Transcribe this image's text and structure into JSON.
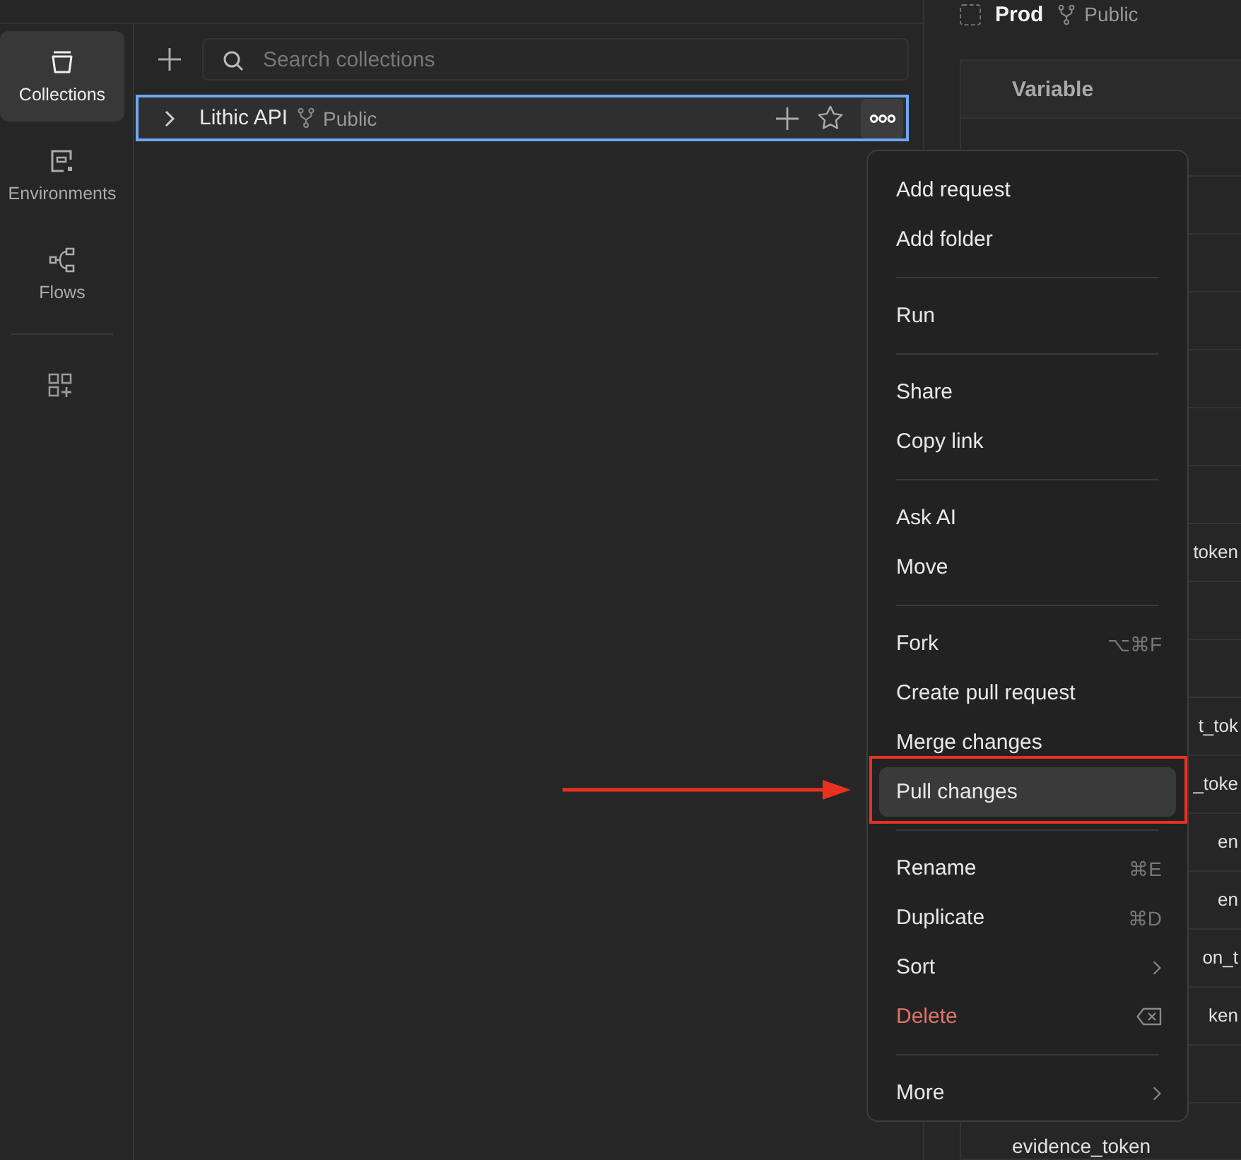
{
  "nav": [
    {
      "label": "Collections",
      "selected": true
    },
    {
      "label": "Environments",
      "selected": false
    },
    {
      "label": "Flows",
      "selected": false
    }
  ],
  "search": {
    "placeholder": "Search collections"
  },
  "collection": {
    "name": "Lithic API",
    "visibility": "Public",
    "selected": true
  },
  "environment": {
    "name": "Prod",
    "visibility": "Public"
  },
  "table": {
    "columns": [
      "Variable"
    ],
    "rows": [
      {
        "kind": "blank"
      },
      {
        "kind": "blank"
      },
      {
        "kind": "blank"
      },
      {
        "kind": "blank"
      },
      {
        "kind": "blank"
      },
      {
        "kind": "blank"
      },
      {
        "kind": "blank"
      },
      {
        "kind": "cut",
        "variable": "token"
      },
      {
        "kind": "blank"
      },
      {
        "kind": "blank"
      },
      {
        "kind": "cut",
        "variable": "t_tok"
      },
      {
        "kind": "cut",
        "variable": "_toke"
      },
      {
        "kind": "cut",
        "variable": "en"
      },
      {
        "kind": "cut",
        "variable": "en"
      },
      {
        "kind": "cut",
        "variable": "on_t"
      },
      {
        "kind": "cut",
        "variable": "ken"
      },
      {
        "kind": "blank"
      },
      {
        "kind": "full",
        "variable": "evidence_token"
      }
    ]
  },
  "menu": [
    {
      "items": [
        {
          "label": "Add request",
          "kind": "plain",
          "selected": false
        },
        {
          "label": "Add folder",
          "kind": "plain",
          "selected": false
        }
      ]
    },
    {
      "items": [
        {
          "label": "Run",
          "kind": "plain",
          "selected": false
        }
      ]
    },
    {
      "items": [
        {
          "label": "Share",
          "kind": "plain",
          "selected": false
        },
        {
          "label": "Copy link",
          "kind": "plain",
          "selected": false
        }
      ]
    },
    {
      "items": [
        {
          "label": "Ask AI",
          "kind": "plain",
          "selected": false
        },
        {
          "label": "Move",
          "kind": "plain",
          "selected": false
        }
      ]
    },
    {
      "items": [
        {
          "label": "Fork",
          "kind": "shortcut",
          "shortcut": "⌥⌘F",
          "selected": false
        },
        {
          "label": "Create pull request",
          "kind": "plain",
          "selected": false
        },
        {
          "label": "Merge changes",
          "kind": "plain",
          "selected": false
        },
        {
          "label": "Pull changes",
          "kind": "plain",
          "selected": true
        }
      ]
    },
    {
      "items": [
        {
          "label": "Rename",
          "kind": "shortcut",
          "shortcut": "⌘E",
          "selected": false
        },
        {
          "label": "Duplicate",
          "kind": "shortcut",
          "shortcut": "⌘D",
          "selected": false
        },
        {
          "label": "Sort",
          "kind": "submenu",
          "selected": false
        },
        {
          "label": "Delete",
          "kind": "danger",
          "selected": false
        }
      ]
    },
    {
      "items": [
        {
          "label": "More",
          "kind": "submenu",
          "selected": false
        }
      ]
    }
  ]
}
